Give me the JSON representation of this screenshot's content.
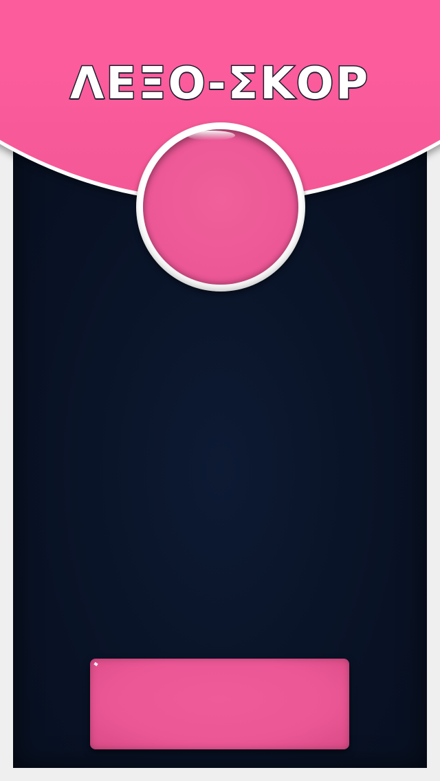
{
  "app": {
    "title": "ΛΕΞΟ-ΣΚΟΡ"
  },
  "tap_button": {
    "label": ""
  },
  "action_panel": {
    "label": ""
  },
  "colors": {
    "accent": "#fc5c9c",
    "button": "#ec5796",
    "board_background": "#0a1428",
    "frame": "#efefef",
    "title_outline": "#1b1c2e"
  }
}
